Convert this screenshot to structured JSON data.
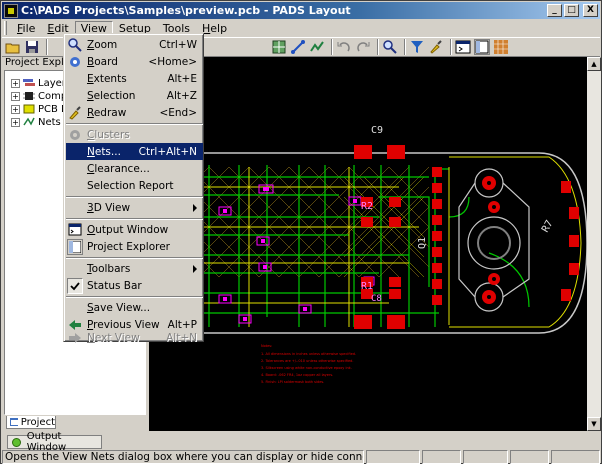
{
  "window": {
    "title": "C:\\PADS Projects\\Samples\\preview.pcb - PADS Layout",
    "min_label": "_",
    "max_label": "□",
    "close_label": "X"
  },
  "menubar": [
    {
      "label": "File",
      "u": "F",
      "rest": "ile"
    },
    {
      "label": "Edit",
      "u": "E",
      "rest": "dit"
    },
    {
      "label": "View",
      "u": "V",
      "rest": "iew"
    },
    {
      "label": "Setup",
      "u": "S",
      "rest": "etup"
    },
    {
      "label": "Tools",
      "u": "T",
      "rest": "ools"
    },
    {
      "label": "Help",
      "u": "H",
      "rest": "elp"
    }
  ],
  "explorer": {
    "header": "Project Explorer",
    "nodes": [
      "Layers",
      "Components",
      "PCB Decals",
      "Nets"
    ],
    "tab_label": "Project"
  },
  "view_menu": {
    "items": [
      {
        "label": "Zoom",
        "u": "Z",
        "rest": "oom",
        "shortcut": "Ctrl+W",
        "icon": "zoom-icon"
      },
      {
        "label": "Board",
        "u": "B",
        "rest": "oard",
        "shortcut": "<Home>",
        "icon": "board-icon"
      },
      {
        "label": "Extents",
        "u": "E",
        "rest": "xtents",
        "shortcut": "Alt+E",
        "icon": ""
      },
      {
        "label": "Selection",
        "u": "S",
        "rest": "election",
        "shortcut": "Alt+Z",
        "icon": ""
      },
      {
        "label": "Redraw",
        "u": "R",
        "rest": "edraw",
        "shortcut": "<End>",
        "icon": "redraw-icon"
      },
      {
        "label": "Clusters",
        "u": "C",
        "rest": "lusters",
        "shortcut": "",
        "icon": "clusters-icon",
        "disabled": true
      },
      {
        "label": "Nets...",
        "u": "N",
        "rest": "ets...",
        "shortcut": "Ctrl+Alt+N",
        "icon": "",
        "highlighted": true
      },
      {
        "label": "Clearance...",
        "u": "C",
        "rest": "learance...",
        "shortcut": "",
        "icon": ""
      },
      {
        "label": "Selection Report",
        "u": "",
        "rest": "Selection Report",
        "shortcut": "",
        "icon": ""
      },
      {
        "label": "3D View",
        "u": "3",
        "rest": "D View",
        "shortcut": "",
        "icon": "",
        "submenu": true
      },
      {
        "label": "Output Window",
        "u": "O",
        "rest": "utput Window",
        "shortcut": "",
        "icon": "output-window-icon"
      },
      {
        "label": "Project Explorer",
        "u": "",
        "rest": "Project Explorer",
        "shortcut": "",
        "icon": "project-explorer-icon"
      },
      {
        "label": "Toolbars",
        "u": "T",
        "rest": "oolbars",
        "shortcut": "",
        "icon": "",
        "submenu": true
      },
      {
        "label": "Status Bar",
        "u": "",
        "rest": "Status Bar",
        "shortcut": "",
        "icon": "check-icon"
      },
      {
        "label": "Save View...",
        "u": "S",
        "rest": "ave View...",
        "shortcut": "",
        "icon": ""
      },
      {
        "label": "Previous View",
        "u": "P",
        "rest": "revious View",
        "shortcut": "Alt+P",
        "icon": "previous-view-icon"
      },
      {
        "label": "Next View",
        "u": "N",
        "rest": "ext View",
        "shortcut": "Alt+N",
        "icon": "next-view-icon",
        "disabled": true
      }
    ]
  },
  "pcb_labels": {
    "c9": "C9",
    "r2": "R2",
    "r1": "R1",
    "c8": "C8",
    "q1": "Q1",
    "r7": "R7"
  },
  "pcb_notes": [
    "Notes:",
    "1. All dimensions in inches unless otherwise specified.",
    "2. Tolerances are +/-.010 unless otherwise specified.",
    "3. Silkscreen using white non-conductive epoxy ink.",
    "4. Board: .062 FR4, 1oz copper all layers.",
    "5. Finish: LPI soldermask both sides."
  ],
  "output_tab": "Output Window",
  "status": {
    "message": "Opens the View Nets dialog box where you can display or hide connections by Net N"
  },
  "colors": {
    "title_start": "#0a246a",
    "highlight": "#0a246a",
    "board_outline": "#c8c8c8",
    "trace_green": "#00c800",
    "trace_yellow": "#e0e000",
    "pad_red": "#e00000",
    "silk_magenta": "#ff00ff"
  }
}
